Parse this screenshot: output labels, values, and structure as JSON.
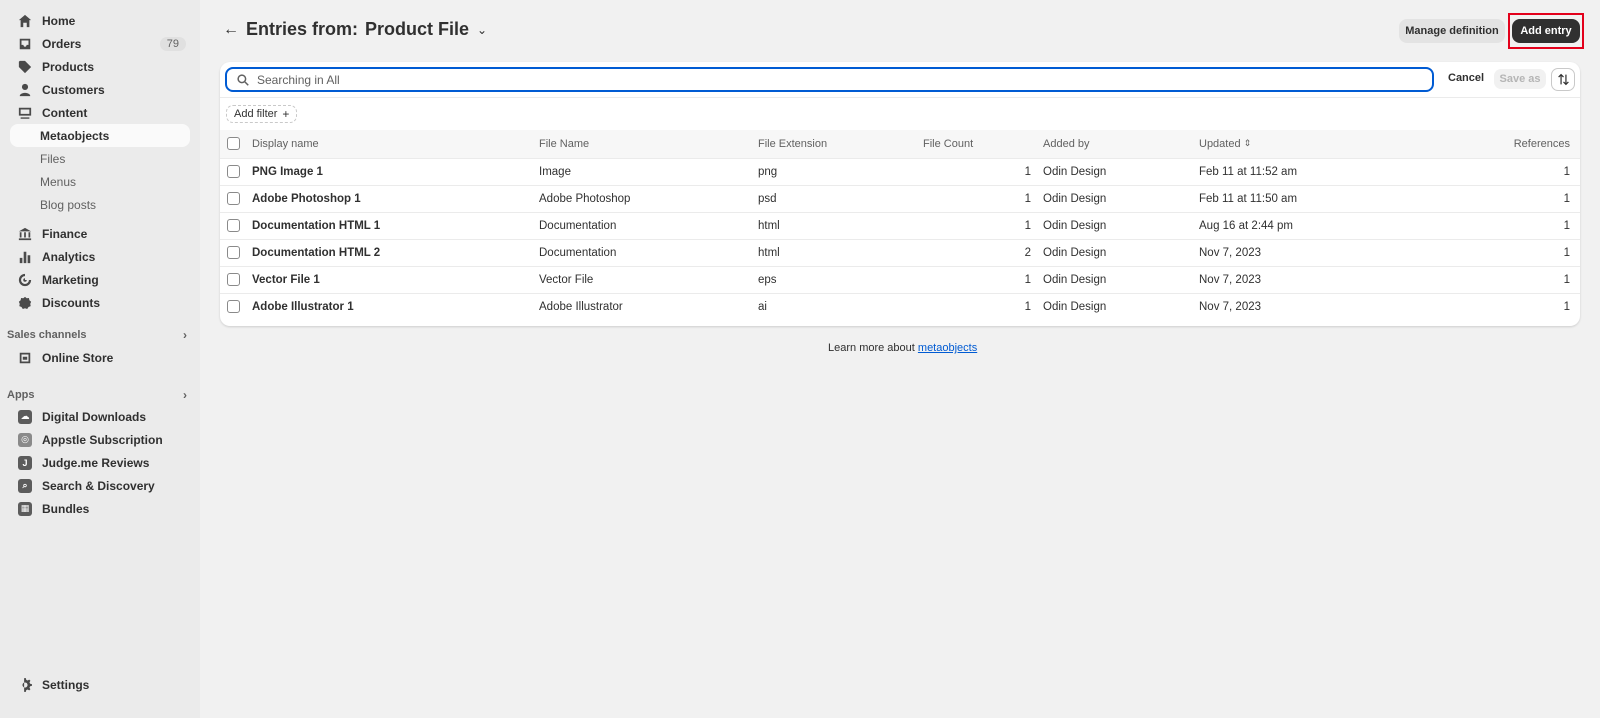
{
  "sidebar": {
    "items": [
      {
        "label": "Home",
        "icon": "home-icon"
      },
      {
        "label": "Orders",
        "icon": "inbox-icon",
        "badge": "79"
      },
      {
        "label": "Products",
        "icon": "tag-icon"
      },
      {
        "label": "Customers",
        "icon": "person-icon"
      },
      {
        "label": "Content",
        "icon": "image-icon"
      },
      {
        "label": "Metaobjects"
      },
      {
        "label": "Files"
      },
      {
        "label": "Menus"
      },
      {
        "label": "Blog posts"
      },
      {
        "label": "Finance",
        "icon": "bank-icon"
      },
      {
        "label": "Analytics",
        "icon": "bar-chart-icon"
      },
      {
        "label": "Marketing",
        "icon": "target-icon"
      },
      {
        "label": "Discounts",
        "icon": "discount-icon"
      }
    ],
    "sales_channels_title": "Sales channels",
    "sales_channels": [
      {
        "label": "Online Store",
        "icon": "store-icon"
      }
    ],
    "apps_title": "Apps",
    "apps": [
      {
        "label": "Digital Downloads",
        "icon": "cloud-download-icon"
      },
      {
        "label": "Appstle Subscription",
        "icon": "appstle-icon"
      },
      {
        "label": "Judge.me Reviews",
        "icon": "judgeme-icon",
        "glyph": "J"
      },
      {
        "label": "Search & Discovery",
        "icon": "search-app-icon"
      },
      {
        "label": "Bundles",
        "icon": "bundles-icon"
      }
    ],
    "settings_label": "Settings"
  },
  "header": {
    "title_prefix": "Entries from:",
    "title_name": "Product File",
    "manage_definition_label": "Manage definition",
    "add_entry_label": "Add entry"
  },
  "toolbar": {
    "search_placeholder": "Searching in All",
    "cancel_label": "Cancel",
    "save_as_label": "Save as",
    "add_filter_label": "Add filter"
  },
  "table": {
    "columns": [
      "Display name",
      "File Name",
      "File Extension",
      "File Count",
      "Added by",
      "Updated",
      "References"
    ],
    "rows": [
      {
        "name": "PNG Image 1",
        "file": "Image",
        "ext": "png",
        "count": "1",
        "added": "Odin Design",
        "updated": "Feb 11 at 11:52 am",
        "refs": "1"
      },
      {
        "name": "Adobe Photoshop 1",
        "file": "Adobe Photoshop",
        "ext": "psd",
        "count": "1",
        "added": "Odin Design",
        "updated": "Feb 11 at 11:50 am",
        "refs": "1"
      },
      {
        "name": "Documentation HTML 1",
        "file": "Documentation",
        "ext": "html",
        "count": "1",
        "added": "Odin Design",
        "updated": "Aug 16 at 2:44 pm",
        "refs": "1"
      },
      {
        "name": "Documentation HTML 2",
        "file": "Documentation",
        "ext": "html",
        "count": "2",
        "added": "Odin Design",
        "updated": "Nov 7, 2023",
        "refs": "1"
      },
      {
        "name": "Vector File 1",
        "file": "Vector File",
        "ext": "eps",
        "count": "1",
        "added": "Odin Design",
        "updated": "Nov 7, 2023",
        "refs": "1"
      },
      {
        "name": "Adobe Illustrator 1",
        "file": "Adobe Illustrator",
        "ext": "ai",
        "count": "1",
        "added": "Odin Design",
        "updated": "Nov 7, 2023",
        "refs": "1"
      }
    ]
  },
  "footer": {
    "learn_more_text": "Learn more about",
    "learn_more_link": "metaobjects"
  }
}
